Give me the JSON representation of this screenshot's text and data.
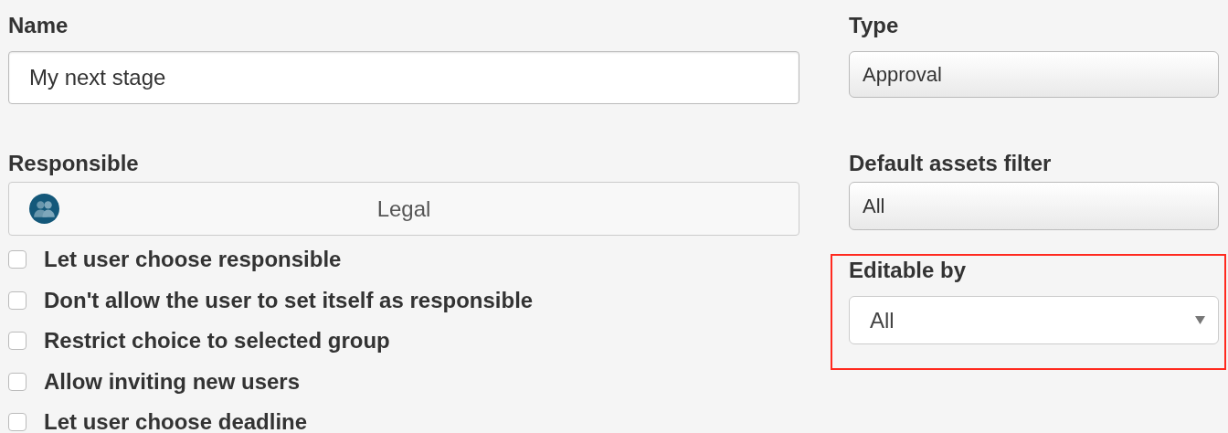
{
  "name_field": {
    "label": "Name",
    "value": "My next stage"
  },
  "responsible": {
    "label": "Responsible",
    "value": "Legal"
  },
  "options": [
    {
      "label": "Let user choose responsible",
      "checked": false
    },
    {
      "label": "Don't allow the user to set itself as responsible",
      "checked": false
    },
    {
      "label": "Restrict choice to selected group",
      "checked": false
    },
    {
      "label": "Allow inviting new users",
      "checked": false
    },
    {
      "label": "Let user choose deadline",
      "checked": false
    }
  ],
  "type_field": {
    "label": "Type",
    "value": "Approval"
  },
  "assets_filter": {
    "label": "Default assets filter",
    "value": "All"
  },
  "editable_by": {
    "label": "Editable by",
    "value": "All",
    "highlighted": true
  }
}
